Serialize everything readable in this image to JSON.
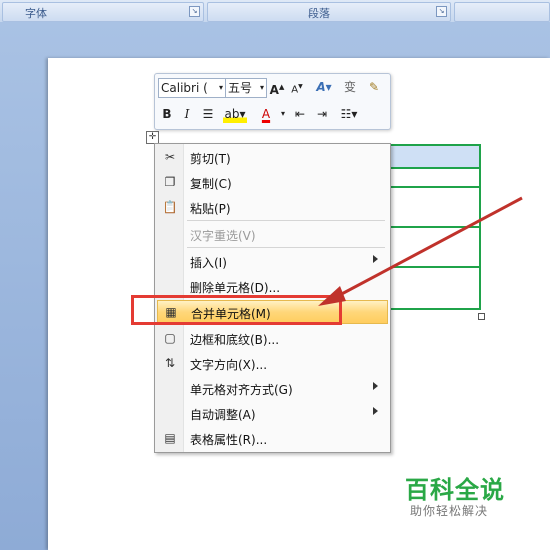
{
  "ribbon": {
    "groups": [
      {
        "label": "字体"
      },
      {
        "label": "段落"
      }
    ]
  },
  "mini_toolbar": {
    "font_name": "Calibri (",
    "font_size": "五号",
    "row2": [
      "B",
      "I",
      "A"
    ]
  },
  "context_menu": {
    "items": [
      {
        "label": "剪切(T)",
        "icon": "scissors-icon"
      },
      {
        "label": "复制(C)",
        "icon": "copy-icon"
      },
      {
        "label": "粘贴(P)",
        "icon": "paste-icon"
      },
      {
        "label": "汉字重选(V)",
        "disabled": true
      },
      {
        "label": "插入(I)",
        "submenu": true
      },
      {
        "label": "删除单元格(D)..."
      },
      {
        "label": "合并单元格(M)",
        "icon": "merge-cells-icon",
        "highlighted": true
      },
      {
        "label": "边框和底纹(B)...",
        "icon": "border-icon"
      },
      {
        "label": "文字方向(X)...",
        "icon": "text-direction-icon"
      },
      {
        "label": "单元格对齐方式(G)",
        "submenu": true
      },
      {
        "label": "自动调整(A)",
        "submenu": true
      },
      {
        "label": "表格属性(R)...",
        "icon": "table-properties-icon"
      }
    ]
  },
  "watermark": {
    "title": "百科全说",
    "subtitle": "助你轻松解决"
  },
  "colors": {
    "highlight_red": "#e43b33",
    "table_border": "#1fa34a",
    "menu_highlight": "#ffd77a",
    "watermark_green": "#2aa846"
  }
}
